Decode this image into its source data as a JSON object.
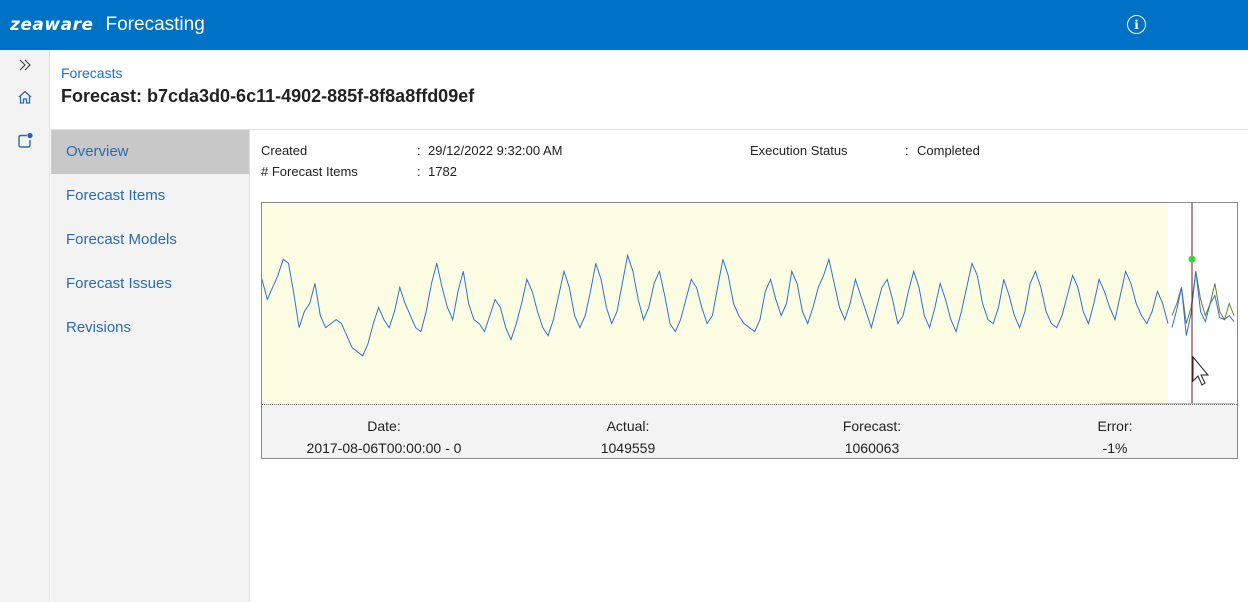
{
  "app": {
    "logo": "zeaware",
    "product": "Forecasting"
  },
  "header": {
    "breadcrumb": "Forecasts",
    "title": "Forecast: b7cda3d0-6c11-4902-885f-8f8a8ffd09ef"
  },
  "nav": {
    "items": [
      {
        "label": "Overview",
        "active": true
      },
      {
        "label": "Forecast Items",
        "active": false
      },
      {
        "label": "Forecast Models",
        "active": false
      },
      {
        "label": "Forecast Issues",
        "active": false
      },
      {
        "label": "Revisions",
        "active": false
      }
    ]
  },
  "properties": {
    "created_label": "Created",
    "created_value": "29/12/2022 9:32:00 AM",
    "items_label": "# Forecast Items",
    "items_value": "1782",
    "status_label": "Execution Status",
    "status_value": "Completed",
    "separator": ":"
  },
  "chart_data": {
    "type": "line",
    "series": [
      {
        "values": [
          62,
          52,
          58,
          64,
          72,
          70,
          55,
          38,
          46,
          50,
          60,
          44,
          38,
          40,
          42,
          40,
          34,
          28,
          26,
          24,
          30,
          40,
          48,
          42,
          38,
          46,
          58,
          50,
          44,
          38,
          36,
          46,
          60,
          70,
          58,
          48,
          42,
          56,
          66,
          50,
          42,
          40,
          36,
          44,
          52,
          48,
          38,
          32,
          40,
          50,
          62,
          56,
          46,
          38,
          34,
          42,
          54,
          66,
          58,
          44,
          38,
          44,
          56,
          70,
          62,
          48,
          40,
          46,
          60,
          74,
          66,
          52,
          42,
          48,
          60,
          66,
          54,
          40,
          36,
          42,
          52,
          62,
          58,
          48,
          40,
          44,
          58,
          72,
          64,
          50,
          44,
          40,
          38,
          36,
          42,
          56,
          62,
          52,
          44,
          50,
          66,
          60,
          46,
          40,
          48,
          58,
          64,
          72,
          60,
          48,
          42,
          50,
          62,
          54,
          46,
          38,
          48,
          58,
          62,
          52,
          40,
          44,
          56,
          66,
          58,
          44,
          38,
          48,
          60,
          52,
          42,
          36,
          46,
          58,
          70,
          64,
          50,
          42,
          40,
          48,
          62,
          54,
          44,
          38,
          46,
          60,
          66,
          58,
          46,
          40,
          38,
          44,
          54,
          64,
          58,
          46,
          40,
          50,
          62,
          56,
          48,
          42,
          54,
          66,
          60,
          50,
          44,
          40,
          46,
          56,
          50,
          40
        ]
      },
      {
        "values": [
          44,
          50,
          58,
          40,
          48,
          66,
          52,
          44,
          50,
          60,
          46,
          42,
          50,
          44
        ]
      }
    ],
    "highlighted_point": {
      "date": "2017-08-06T00:00:00 - 0",
      "actual": 1049559,
      "forecast": 1060063,
      "error": "-1%"
    },
    "colors": {
      "actual_line": "#2d73d1",
      "forecast_line": "#6b7d3a",
      "history_background": "#fdfde4",
      "marker": "#3ad43a",
      "cursor_line": "#7a1a1a"
    }
  },
  "readout": {
    "date_label": "Date:",
    "date_value": "2017-08-06T00:00:00 - 0",
    "actual_label": "Actual:",
    "actual_value": "1049559",
    "forecast_label": "Forecast:",
    "forecast_value": "1060063",
    "error_label": "Error:",
    "error_value": "-1%"
  },
  "icons": {
    "expand": "double-chevron-right-icon",
    "home": "home-icon",
    "notifications": "notification-icon",
    "info": "info-icon"
  }
}
